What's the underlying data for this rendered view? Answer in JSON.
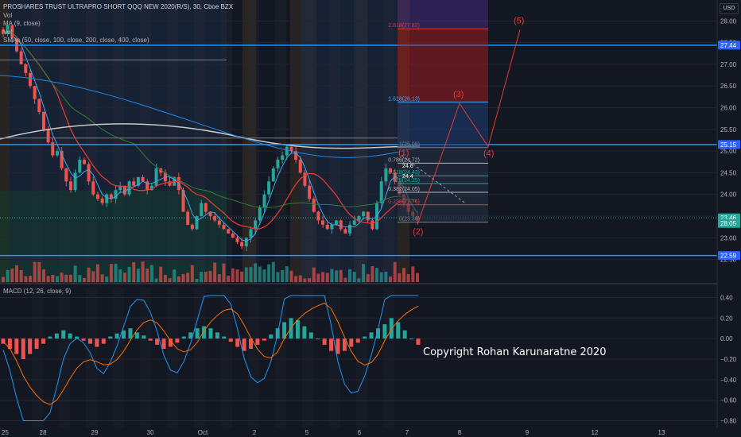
{
  "legend": {
    "title": "PROSHARES TRUST ULTRAPRO SHORT QQQ NEW 2020(R/S), 30, Cboe BZX",
    "lines": [
      "Vol",
      "MA (9, close)",
      "Vol",
      "SMAs (50, close, 100, close, 200, close, 400, close)"
    ]
  },
  "macd_legend": "MACD (12, 26, close, 9)",
  "currency": "USD",
  "copyright": "Copyright Rohan Karunaratne 2020",
  "price_axis": {
    "ticks": [
      "28.00",
      "27.50",
      "27.00",
      "26.50",
      "26.00",
      "25.50",
      "25.00",
      "24.50",
      "24.00",
      "23.50",
      "23.00",
      "22.50"
    ],
    "values": [
      28.0,
      27.5,
      27.0,
      26.5,
      26.0,
      25.5,
      25.0,
      24.5,
      24.0,
      23.5,
      23.0,
      22.5
    ],
    "badges": [
      {
        "label": "27.44",
        "value": 27.44,
        "color": "#2962ff"
      },
      {
        "label": "25.15",
        "value": 25.15,
        "color": "#2962ff"
      },
      {
        "label": "23.46",
        "value": 23.46,
        "color": "#26a69a"
      },
      {
        "label": "28:05",
        "value": 23.33,
        "color": "#26a69a"
      },
      {
        "label": "22.59",
        "value": 22.59,
        "color": "#2962ff"
      }
    ]
  },
  "macd_axis": {
    "ticks": [
      "0.40",
      "0.20",
      "0.00",
      "−0.20",
      "−0.40",
      "−0.60",
      "−0.80"
    ],
    "values": [
      0.4,
      0.2,
      0.0,
      -0.2,
      -0.4,
      -0.6,
      -0.8
    ]
  },
  "time_axis": {
    "labels": [
      "25",
      "28",
      "29",
      "30",
      "Oct",
      "2",
      "5",
      "6",
      "7",
      "8",
      "9",
      "12",
      "13"
    ]
  },
  "fib_levels": [
    {
      "label": "2.618(27.82)",
      "value": 27.82,
      "color": "#e53935"
    },
    {
      "label": "1.618(26.13)",
      "value": 26.13,
      "color": "#42a5f5"
    },
    {
      "label": "1(25.08)",
      "value": 25.08,
      "color": "#787b86"
    },
    {
      "label": "0.786(24.72)",
      "value": 24.72,
      "color": "#b2b5be"
    },
    {
      "label": "0.618(24.43)",
      "value": 24.43,
      "color": "#26a69a"
    },
    {
      "label": "0.5(24.25)",
      "value": 24.25,
      "color": "#26a69a"
    },
    {
      "label": "0.382(24.05)",
      "value": 24.05,
      "color": "#b2b5be"
    },
    {
      "label": "0.236(23.76)",
      "value": 23.76,
      "color": "#e53935"
    },
    {
      "label": "0(23.36)",
      "value": 23.36,
      "color": "#787b86"
    }
  ],
  "annotations": {
    "marks": [
      "24.6",
      "24.4"
    ],
    "waves": [
      "(1)",
      "(2)",
      "(3)",
      "(4)",
      "(5)"
    ]
  },
  "horizontal_levels": [
    27.44,
    25.15,
    22.59
  ],
  "chart_data": {
    "type": "candlestick",
    "title": "PROSHARES TRUST ULTRAPRO SHORT QQQ NEW 2020(R/S), 30, Cboe BZX",
    "interval": "30",
    "ylim": [
      22.4,
      28.3
    ],
    "close_series": [
      27.7,
      27.9,
      27.6,
      27.3,
      27.0,
      26.8,
      26.5,
      26.2,
      25.9,
      25.5,
      25.2,
      24.9,
      25.0,
      24.6,
      24.3,
      24.1,
      24.5,
      24.8,
      24.7,
      24.3,
      24.0,
      23.9,
      23.8,
      24.0,
      23.9,
      24.1,
      24.2,
      24.0,
      24.3,
      24.2,
      24.4,
      24.3,
      24.1,
      24.2,
      24.6,
      24.5,
      24.3,
      24.2,
      24.4,
      24.1,
      23.6,
      23.3,
      23.2,
      23.5,
      23.8,
      23.6,
      23.5,
      23.4,
      23.3,
      23.2,
      23.1,
      23.0,
      22.9,
      22.8,
      23.0,
      23.2,
      23.4,
      23.7,
      24.0,
      24.3,
      24.6,
      24.8,
      24.9,
      25.1,
      25.0,
      24.8,
      24.5,
      24.2,
      23.9,
      23.6,
      23.4,
      23.3,
      23.2,
      23.3,
      23.4,
      23.2,
      23.1,
      23.3,
      23.4,
      23.5,
      23.6,
      23.4,
      23.2,
      23.8,
      24.3,
      24.6,
      24.5,
      24.3,
      24.0,
      23.8,
      23.6,
      23.5,
      23.4
    ],
    "horizontal_levels": [
      27.44,
      25.15,
      22.59
    ],
    "last_price": 23.46,
    "projection_waves": [
      {
        "label": "(1)",
        "price": 24.75
      },
      {
        "label": "(2)",
        "price": 23.3
      },
      {
        "label": "(3)",
        "price": 26.1
      },
      {
        "label": "(4)",
        "price": 25.1
      },
      {
        "label": "(5)",
        "price": 27.8
      }
    ],
    "fibonacci": [
      {
        "ratio": 2.618,
        "price": 27.82
      },
      {
        "ratio": 1.618,
        "price": 26.13
      },
      {
        "ratio": 1,
        "price": 25.08
      },
      {
        "ratio": 0.786,
        "price": 24.72
      },
      {
        "ratio": 0.618,
        "price": 24.43
      },
      {
        "ratio": 0.5,
        "price": 24.25
      },
      {
        "ratio": 0.382,
        "price": 24.05
      },
      {
        "ratio": 0.236,
        "price": 23.76
      },
      {
        "ratio": 0,
        "price": 23.36
      }
    ],
    "macd": {
      "name": "MACD (12, 26, close, 9)",
      "ylim": [
        -0.85,
        0.45
      ],
      "histogram": [
        -0.05,
        -0.1,
        -0.15,
        -0.2,
        -0.15,
        -0.1,
        -0.05,
        0.02,
        0.05,
        0.08,
        0.05,
        0.02,
        -0.02,
        -0.05,
        -0.08,
        -0.05,
        0.02,
        0.05,
        0.08,
        0.1,
        0.06,
        0.03,
        -0.02,
        -0.06,
        -0.1,
        -0.08,
        -0.04,
        0.02,
        0.06,
        0.1,
        0.12,
        0.1,
        0.06,
        0.02,
        -0.03,
        -0.08,
        -0.12,
        -0.1,
        -0.06,
        -0.02,
        0.04,
        0.1,
        0.16,
        0.2,
        0.18,
        0.12,
        0.06,
        0.0,
        -0.06,
        -0.12,
        -0.15,
        -0.12,
        -0.08,
        -0.04,
        0.02,
        0.06,
        0.1,
        0.14,
        0.2,
        0.16,
        0.08,
        0.0,
        -0.06
      ]
    }
  }
}
